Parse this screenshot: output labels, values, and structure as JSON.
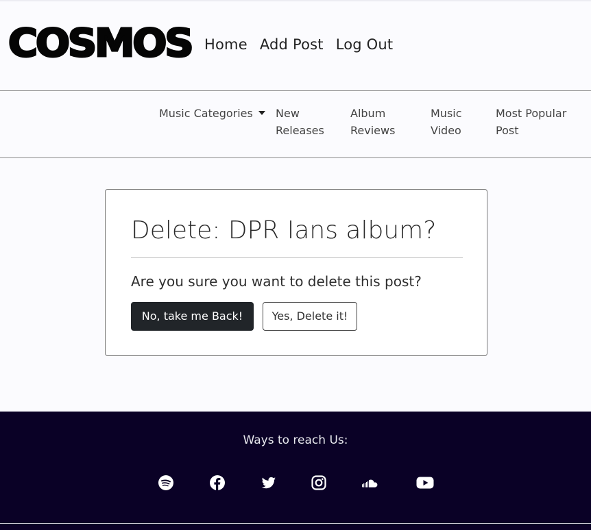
{
  "header": {
    "logo": "COSMOS",
    "nav": [
      "Home",
      "Add Post",
      "Log Out"
    ]
  },
  "subnav": {
    "dropdown_label": "Music Categories",
    "items": [
      [
        "New",
        "Releases"
      ],
      [
        "Album",
        "Reviews"
      ],
      [
        "Music",
        "Video"
      ],
      [
        "Most Popular",
        "Post"
      ]
    ]
  },
  "dialog": {
    "title": "Delete: DPR Ians album?",
    "message": "Are you sure you want to delete this post?",
    "back_label": "No, take me Back!",
    "delete_label": "Yes, Delete it!"
  },
  "footer": {
    "heading": "Ways to reach Us:",
    "icons": [
      "spotify-icon",
      "facebook-icon",
      "twitter-icon",
      "instagram-icon",
      "soundcloud-icon",
      "youtube-icon"
    ]
  },
  "colors": {
    "footer_bg": "#0a0126",
    "primary_button": "#212529"
  }
}
